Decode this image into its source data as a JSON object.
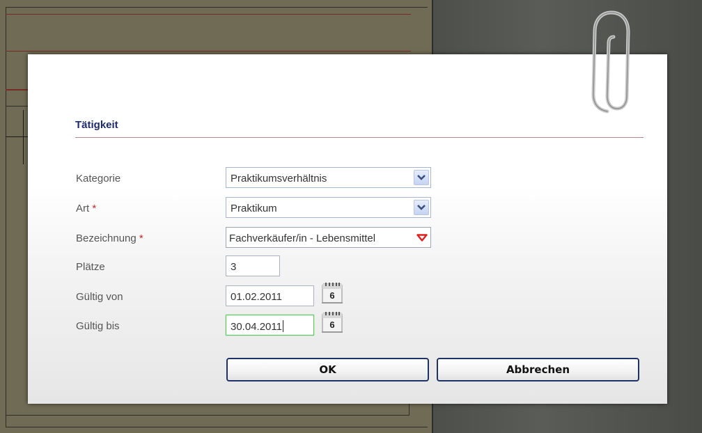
{
  "dialog": {
    "title": "Tätigkeit",
    "fields": {
      "kategorie": {
        "label": "Kategorie",
        "value": "Praktikumsverhältnis"
      },
      "art": {
        "label": "Art",
        "required": "*",
        "value": "Praktikum"
      },
      "bezeichnung": {
        "label": "Bezeichnung",
        "required": "*",
        "value": "Fachverkäufer/in - Lebensmittel"
      },
      "plaetze": {
        "label": "Plätze",
        "value": "3"
      },
      "gueltig_von": {
        "label": "Gültig von",
        "value": "01.02.2011"
      },
      "gueltig_bis": {
        "label": "Gültig bis",
        "value": "30.04.2011"
      }
    },
    "calendar_icon_day": "6",
    "buttons": {
      "ok": "OK",
      "cancel": "Abbrechen"
    }
  },
  "colors": {
    "title": "#1d2a6f",
    "required": "#c8262b",
    "focus_border": "#52d25b",
    "button_border": "#1e3266"
  },
  "icons": [
    "chevron-down-icon",
    "triangle-down-icon",
    "calendar-icon",
    "paperclip-icon"
  ]
}
